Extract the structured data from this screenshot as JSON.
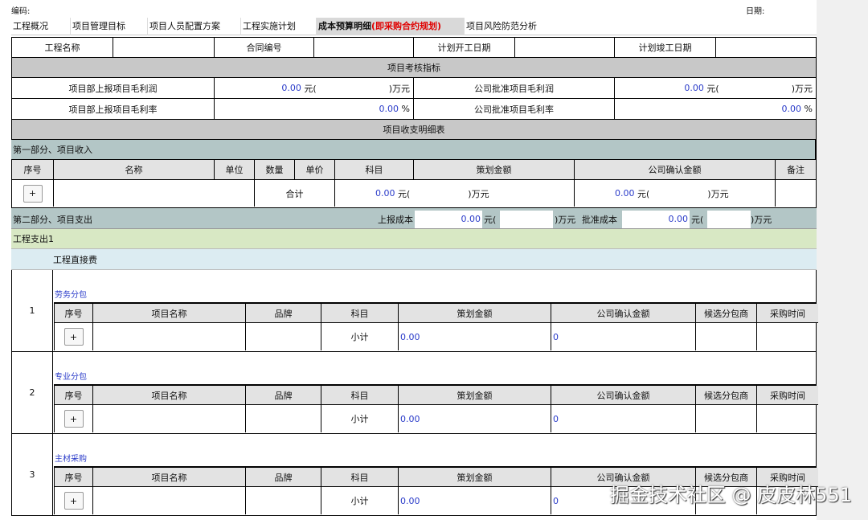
{
  "top": {
    "code_label": "编码:",
    "date_label": "日期:"
  },
  "tabs": [
    {
      "label": "工程概况"
    },
    {
      "label": "项目管理目标"
    },
    {
      "label": "项目人员配置方案"
    },
    {
      "label": "工程实施计划"
    },
    {
      "label": "成本预算明细",
      "highlight": "(即采购合约规划)"
    },
    {
      "label": "项目风险防范分析"
    }
  ],
  "info_row": {
    "project_name": "工程名称",
    "contract_no": "合同编号",
    "planned_start": "计划开工日期",
    "planned_end": "计划竣工日期"
  },
  "kpi": {
    "title": "项目考核指标",
    "r1_left": "项目部上报项目毛利润",
    "r1_left_val": "0.00",
    "r1_right": "公司批准项目毛利润",
    "r1_right_val": "0.00",
    "r2_left": "项目部上报项目毛利率",
    "r2_left_val": "0.00",
    "r2_right": "公司批准项目毛利率",
    "r2_right_val": "0.00",
    "yuan_open": "元(",
    "wan_close": ")万元",
    "pct": "%"
  },
  "income": {
    "detail_title": "项目收支明细表",
    "section": "第一部分、项目收入",
    "headers": [
      "序号",
      "名称",
      "单位",
      "数量",
      "单价",
      "科目",
      "策划金额",
      "公司确认金额",
      "备注"
    ],
    "add": "+",
    "total": "合计",
    "plan_total": "0.00",
    "confirm_total": "0.00"
  },
  "expense": {
    "section": "第二部分、项目支出",
    "reported_label": "上报成本",
    "reported_val": "0.00",
    "approved_label": "批准成本",
    "approved_val": "0.00",
    "sub1": "工程支出1",
    "direct": "工程直接费",
    "headers": [
      "序号",
      "项目名称",
      "品牌",
      "科目",
      "策划金额",
      "公司确认金额",
      "候选分包商",
      "采购时间"
    ],
    "subtotal": "小计",
    "groups": [
      {
        "no": "1",
        "title": "劳务分包",
        "plan": "0.00",
        "confirm": "0"
      },
      {
        "no": "2",
        "title": "专业分包",
        "plan": "0.00",
        "confirm": "0"
      },
      {
        "no": "3",
        "title": "主材采购",
        "plan": "0.00",
        "confirm": "0"
      }
    ]
  },
  "watermark": "掘金技术社区 @ 皮皮林551"
}
